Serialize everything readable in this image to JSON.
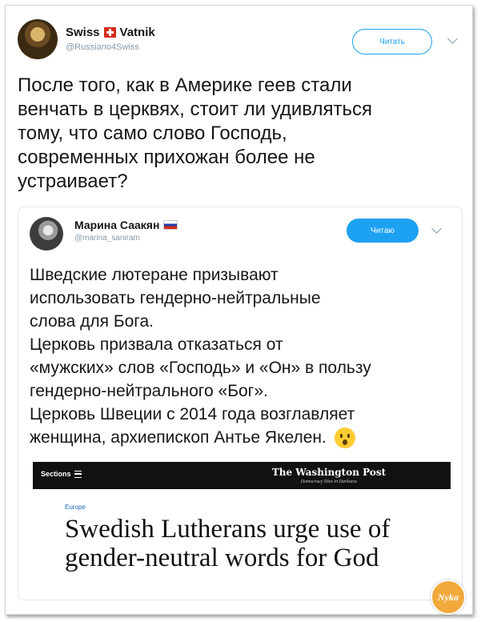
{
  "tweet": {
    "author_name": "Swiss",
    "author_name_suffix": "Vatnik",
    "author_handle": "@Russiano4Swiss",
    "follow_label": "Читать",
    "text": "После того, как в Америке геев стали\nвенчать в церквях, стоит ли удивляться\nтому, что само слово Господь,\nсовременных прихожан более не\nустраивает?"
  },
  "quoted_tweet": {
    "author_name": "Марина Саакян",
    "author_handle": "@marina_saniram",
    "follow_label": "Читаю",
    "text": "Шведские лютеране призывают\nиспользовать гендерно-нейтральные\nслова для Бога.\nЦерковь призвала отказаться от\n«мужских» слов «Господь» и «Он» в пользу\nгендерно-нейтрального «Бог».\nЦерковь Швеции с 2014 года возглавляет\nженщина, архиепископ Антье Якелен.",
    "emoji": "hushed-face-emoji"
  },
  "article_card": {
    "sections_label": "Sections",
    "publication": "The Washington Post",
    "tagline": "Democracy Dies in Darkness",
    "section": "Europe",
    "headline": "Swedish Lutherans urge use of gender-neutral words for God"
  },
  "watermark": {
    "text": "Nyka"
  },
  "colors": {
    "accent": "#1da1f2",
    "text": "#14171a",
    "muted": "#8899a6"
  }
}
